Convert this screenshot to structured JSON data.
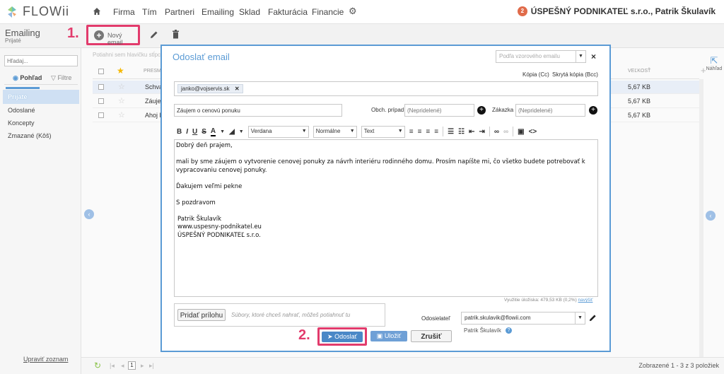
{
  "app": {
    "logo_text": "FLOWii"
  },
  "nav": {
    "items": [
      "Firma",
      "Tím",
      "Partneri",
      "Emailing",
      "Sklad",
      "Fakturácia",
      "Financie"
    ],
    "company": "ÚSPEŠNÝ PODNIKATEĽ s.r.o., Patrik Škulavík",
    "notif": "2"
  },
  "page": {
    "title": "Emailing",
    "subtitle": "Prijaté"
  },
  "toolbar": {
    "new_email": "Nový email",
    "step1": "1."
  },
  "sidebar": {
    "search_placeholder": "Hľadaj...",
    "view_tab": "Pohľad",
    "filter_tab": "Filtre",
    "items": [
      "Prijaté",
      "Odoslané",
      "Koncepty",
      "Zmazané (Kôš)"
    ],
    "edit_list": "Upraviť zoznam"
  },
  "list": {
    "group_hint": "Potiahni sem hlavičku stĺpca",
    "col_sender": "PRESM",
    "col_size": "VEĽKOSŤ",
    "rows": [
      {
        "subject": "Schvá",
        "size": "5,67 KB"
      },
      {
        "subject": "Záujem",
        "size": "5,67 KB"
      },
      {
        "subject": "Ahoj F",
        "size": "5,67 KB"
      }
    ],
    "footer_count": "Zobrazené 1 - 3 z 3 položiek",
    "page": "1",
    "preview": "Náhľad"
  },
  "modal": {
    "title": "Odoslať email",
    "template_placeholder": "Podľa vzorového emailu",
    "cc": "Kópia (Cc)",
    "bcc": "Skrytá kópia (Bcc)",
    "recipient": "janko@vojservis.sk",
    "subject": "Záujem o cenovú ponuku",
    "case_label": "Obch. prípad",
    "case_placeholder": "(Nepridelené)",
    "order_label": "Zákazka",
    "order_placeholder": "(Nepridelené)",
    "font": "Verdana",
    "size": "Normálne",
    "format": "Text",
    "body": [
      "Dobrý deň prajem,",
      "",
      "mali by sme záujem o vytvorenie cenovej ponuky za návrh interiéru rodinného domu. Prosím napíšte mi, čo všetko budete potrebovať k vypracovaniu cenovej ponuky.",
      "",
      "Ďakujem veľmi pekne",
      "",
      "S pozdravom",
      "",
      "Patrik Škulavík",
      "www.uspesny-podnikatel.eu",
      "ÚSPEŠNÝ PODNIKATEĽ s.r.o."
    ],
    "storage": "Využitie úložiska: 479,53 KB (0,2%)",
    "storage_link": "navýšiť",
    "attach_button": "Pridať prílohu",
    "attach_hint": "Súbory, ktoré chceš nahrať, môžeš potiahnuť tu",
    "sender_label": "Odosielateľ",
    "sender_value": "patrik.skulavik@flowii.com",
    "sender_name": "Patrik Škulavík",
    "send": "Odoslať",
    "save": "Uložiť",
    "cancel": "Zrušiť",
    "step2": "2."
  },
  "colors": {
    "accent": "#5b9bd5",
    "highlight": "#e23b6c",
    "send": "#4a88c7"
  }
}
